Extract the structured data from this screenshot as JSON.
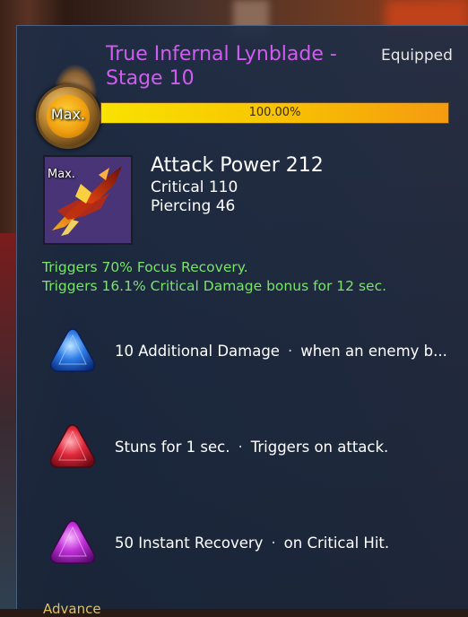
{
  "tooltip": {
    "title": "True Infernal Lynblade - Stage 10",
    "status": "Equipped",
    "grade_badge": "Max.",
    "progress": {
      "label": "100.00%",
      "fraction": 1.0
    },
    "item_icon": {
      "badge": "Max.",
      "icon": "dual-blade-weapon-icon"
    },
    "attack_power": "Attack Power 212",
    "stats": [
      "Critical 110",
      "Piercing 46"
    ],
    "effects": [
      "Triggers 70% Focus Recovery.",
      "Triggers 16.1% Critical Damage bonus for 12 sec."
    ],
    "gems": [
      {
        "icon": "blue-triangle-gem-icon",
        "color": "#2f7de8",
        "effect": "10 Additional Damage",
        "condition": "when an enemy b..."
      },
      {
        "icon": "red-triangle-gem-icon",
        "color": "#e0283a",
        "effect": "Stuns for 1 sec.",
        "condition": "Triggers on attack."
      },
      {
        "icon": "purple-triangle-gem-icon",
        "color": "#c030d8",
        "effect": "50 Instant Recovery",
        "condition": "on Critical Hit."
      }
    ],
    "separator": "·",
    "footer_label": "Advance"
  },
  "colors": {
    "title": "#d05cf0",
    "effect_text": "#7ae36a",
    "panel": "#1e2d46",
    "progress_fill": "#f8d000"
  }
}
